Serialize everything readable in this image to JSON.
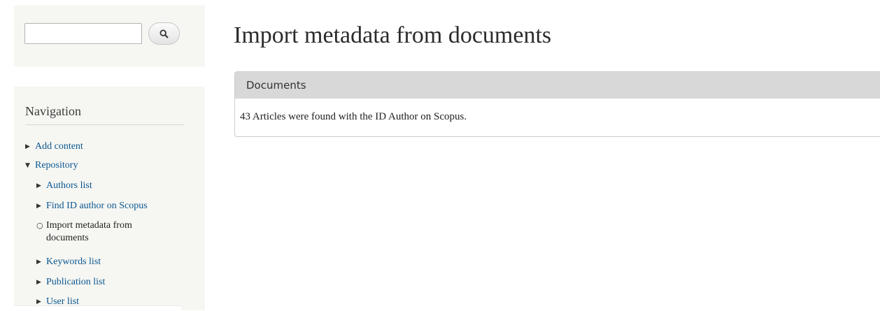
{
  "search": {
    "value": "",
    "button_icon": "search-icon"
  },
  "navigation": {
    "title": "Navigation",
    "items": [
      {
        "label": "Add content",
        "marker": "collapsed-arrow",
        "active": false
      },
      {
        "label": "Repository",
        "marker": "expanded-arrow",
        "active": false
      },
      {
        "label": "Authors list",
        "marker": "collapsed-arrow",
        "active": false
      },
      {
        "label": "Find ID author on Scopus",
        "marker": "collapsed-arrow",
        "active": false
      },
      {
        "label": "Import metadata from documents",
        "marker": "leaf-circle",
        "active": true
      },
      {
        "label": "Keywords list",
        "marker": "collapsed-arrow",
        "active": false
      },
      {
        "label": "Publication list",
        "marker": "collapsed-arrow",
        "active": false
      },
      {
        "label": "User list",
        "marker": "collapsed-arrow",
        "active": false
      }
    ]
  },
  "main": {
    "title": "Import metadata from documents",
    "fieldset": {
      "legend": "Documents",
      "message": "43 Articles were found with the ID Author on Scopus."
    }
  },
  "colors": {
    "link": "#0b5792",
    "sidebar_bg": "#f6f6f2",
    "legend_bg": "#d8d8d8"
  }
}
